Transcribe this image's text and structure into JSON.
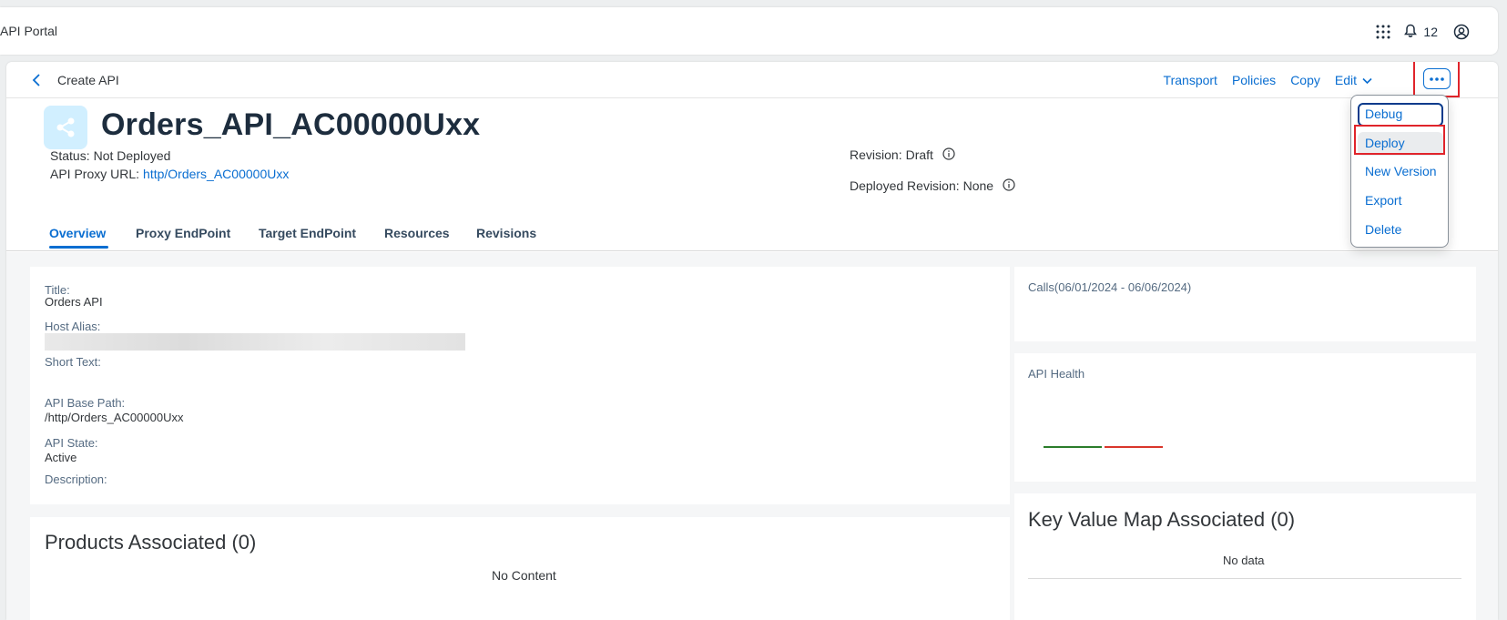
{
  "shell": {
    "title": "API Portal",
    "notification_count": "12",
    "icons": [
      "grid-icon",
      "bell-icon",
      "user-icon"
    ]
  },
  "topbar": {
    "back_icon": "chevron-left-icon",
    "breadcrumb": "Create API",
    "actions": [
      "Transport",
      "Policies",
      "Copy",
      "Edit"
    ],
    "more_icon": "more-icon"
  },
  "header": {
    "object_icon": "share-icon",
    "title": "Orders_API_AC00000Uxx",
    "status_label": "Status:",
    "status_value": "Not Deployed",
    "proxy_url_label": "API Proxy URL:",
    "proxy_url_value": "http/Orders_AC00000Uxx",
    "revision_label": "Revision:",
    "revision_value": "Draft",
    "deployed_revision_label": "Deployed Revision:",
    "deployed_revision_value": "None"
  },
  "tabs": [
    "Overview",
    "Proxy EndPoint",
    "Target EndPoint",
    "Resources",
    "Revisions"
  ],
  "active_tab": "Overview",
  "overview": {
    "title_label": "Title:",
    "title_value": "Orders API",
    "host_alias_label": "Host Alias:",
    "short_text_label": "Short Text:",
    "base_path_label": "API Base Path:",
    "base_path_value": "/http/Orders_AC00000Uxx",
    "state_label": "API State:",
    "state_value": "Active",
    "description_label": "Description:"
  },
  "products": {
    "heading": "Products Associated (0)",
    "empty": "No Content"
  },
  "calls": {
    "heading": "Calls(06/01/2024 - 06/06/2024)"
  },
  "health": {
    "heading": "API Health",
    "colors": [
      "#2b7d2b",
      "#d9362b"
    ]
  },
  "kvm": {
    "heading": "Key Value Map Associated (0)",
    "empty": "No data"
  },
  "menu": {
    "items": [
      "Debug",
      "Deploy",
      "New Version",
      "Export",
      "Delete"
    ],
    "focused": "Debug",
    "highlighted": "Deploy"
  },
  "colors": {
    "accent": "#0a6ed1",
    "highlight": "#e0242b"
  }
}
